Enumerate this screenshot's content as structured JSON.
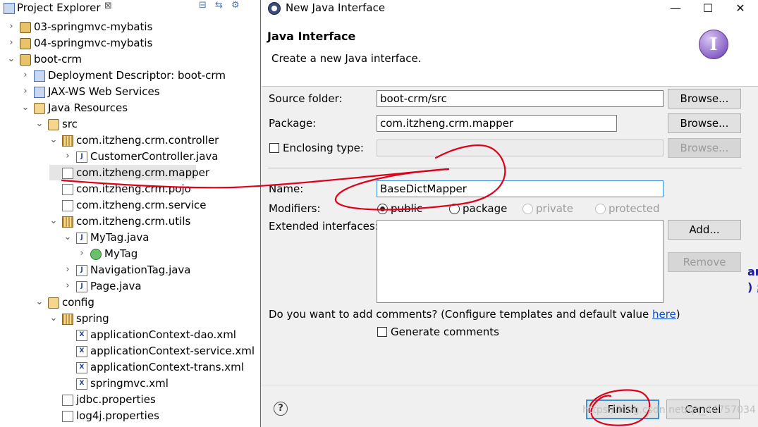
{
  "explorer": {
    "title": "Project Explorer",
    "close_glyph": "⊠",
    "toolbar_glyphs": "⊟ ⇆ ⚙",
    "rows": [
      {
        "label": "03-springmvc-mybatis",
        "twisty": "›",
        "icon": "project-icon"
      },
      {
        "label": "04-springmvc-mybatis",
        "twisty": "›",
        "icon": "project-icon"
      },
      {
        "label": "boot-crm",
        "twisty": "⌄",
        "icon": "project-icon"
      },
      {
        "label": "Deployment Descriptor: boot-crm",
        "twisty": "›",
        "icon": "deployment-descriptor-icon"
      },
      {
        "label": "JAX-WS Web Services",
        "twisty": "›",
        "icon": "web-services-icon"
      },
      {
        "label": "Java Resources",
        "twisty": "⌄",
        "icon": "java-resources-icon"
      },
      {
        "label": "src",
        "twisty": "⌄",
        "icon": "source-folder-icon"
      },
      {
        "label": "com.itzheng.crm.controller",
        "twisty": "⌄",
        "icon": "package-icon"
      },
      {
        "label": "CustomerController.java",
        "twisty": "›",
        "icon": "java-file-icon"
      },
      {
        "label": "com.itzheng.crm.mapper",
        "twisty": "",
        "icon": "empty-package-icon"
      },
      {
        "label": "com.itzheng.crm.pojo",
        "twisty": "",
        "icon": "empty-package-icon"
      },
      {
        "label": "com.itzheng.crm.service",
        "twisty": "",
        "icon": "empty-package-icon"
      },
      {
        "label": "com.itzheng.crm.utils",
        "twisty": "⌄",
        "icon": "package-icon"
      },
      {
        "label": "MyTag.java",
        "twisty": "⌄",
        "icon": "java-file-icon"
      },
      {
        "label": "MyTag",
        "twisty": "›",
        "icon": "class-icon"
      },
      {
        "label": "NavigationTag.java",
        "twisty": "›",
        "icon": "java-file-icon"
      },
      {
        "label": "Page.java",
        "twisty": "›",
        "icon": "java-file-icon"
      },
      {
        "label": "config",
        "twisty": "⌄",
        "icon": "source-folder-icon"
      },
      {
        "label": "spring",
        "twisty": "⌄",
        "icon": "package-icon"
      },
      {
        "label": "applicationContext-dao.xml",
        "twisty": "",
        "icon": "xml-file-icon"
      },
      {
        "label": "applicationContext-service.xml",
        "twisty": "",
        "icon": "xml-file-icon"
      },
      {
        "label": "applicationContext-trans.xml",
        "twisty": "",
        "icon": "xml-file-icon"
      },
      {
        "label": "springmvc.xml",
        "twisty": "",
        "icon": "xml-file-icon"
      },
      {
        "label": "jdbc.properties",
        "twisty": "",
        "icon": "properties-file-icon"
      },
      {
        "label": "log4j.properties",
        "twisty": "",
        "icon": "properties-file-icon"
      }
    ]
  },
  "dialog": {
    "title": "New Java Interface",
    "window_buttons": {
      "minimize": "—",
      "maximize": "☐",
      "close": "✕"
    },
    "heading": "Java Interface",
    "description": "Create a new Java interface.",
    "banner_icon_letter": "I",
    "source_folder": {
      "label": "Source folder:",
      "value": "boot-crm/src",
      "browse": "Browse..."
    },
    "package": {
      "label": "Package:",
      "value": "com.itzheng.crm.mapper",
      "browse": "Browse..."
    },
    "enclosing": {
      "label": "Enclosing type:",
      "value": "",
      "browse": "Browse...",
      "checked": false
    },
    "name": {
      "label": "Name:",
      "value": "BaseDictMapper"
    },
    "modifiers": {
      "label": "Modifiers:",
      "options": [
        "public",
        "package",
        "private",
        "protected"
      ],
      "selected": "public"
    },
    "extended": {
      "label": "Extended interfaces:",
      "add": "Add...",
      "remove": "Remove"
    },
    "comments": {
      "question": "Do you want to add comments? (Configure templates and default value ",
      "link": "here",
      "close_paren": ")",
      "generate_label": "Generate comments",
      "checked": false
    },
    "help_glyph": "?",
    "finish": "Finish",
    "cancel": "Cancel"
  },
  "annotation_color": "#e0001a",
  "watermark": "https://blog.csdn.net/qq_44757034",
  "edge_text": "ar\n) ;"
}
